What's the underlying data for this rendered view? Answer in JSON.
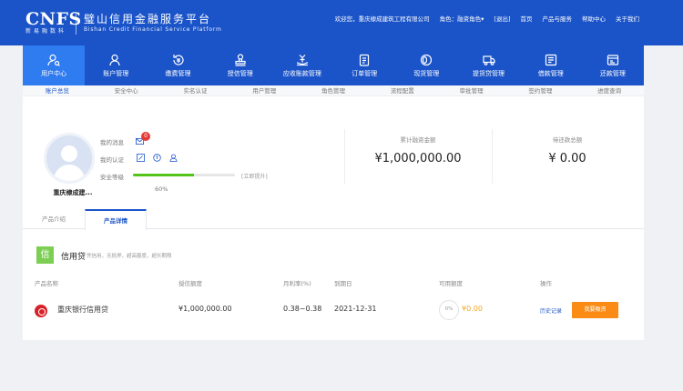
{
  "header": {
    "logo_text": "CNFS",
    "logo_sub": "新易融数科",
    "platform_cn": "璧山信用金融服务平台",
    "platform_en": "Bishan Credit Financial Service Platform",
    "links": [
      "欢迎您，重庆棣成建筑工程有限公司",
      "角色：融资角色▾",
      "[退出]",
      "首页",
      "产品与服务",
      "帮助中心",
      "关于我们"
    ]
  },
  "nav": {
    "items": [
      {
        "label": "用户中心",
        "icon": "user-center-icon"
      },
      {
        "label": "账户管理",
        "icon": "account-icon"
      },
      {
        "label": "缴费管理",
        "icon": "payment-icon"
      },
      {
        "label": "授信管理",
        "icon": "stamp-icon"
      },
      {
        "label": "应收账款管理",
        "icon": "receivable-icon"
      },
      {
        "label": "订单管理",
        "icon": "order-icon"
      },
      {
        "label": "现货管理",
        "icon": "spot-goods-icon"
      },
      {
        "label": "提货贷管理",
        "icon": "truck-icon"
      },
      {
        "label": "借款管理",
        "icon": "loan-icon"
      },
      {
        "label": "还款管理",
        "icon": "repayment-icon"
      }
    ]
  },
  "subtabs": [
    "账户总览",
    "安全中心",
    "实名认证",
    "用户管理",
    "角色管理",
    "流程配置",
    "审批管理",
    "签约管理",
    "进度查询"
  ],
  "profile": {
    "company": "重庆棣成建...",
    "messages_label": "我的消息",
    "messages_count": "0",
    "cert_label": "我的认证",
    "security_label": "安全等级",
    "security_level": 0.6,
    "security_text": "60%",
    "upgrade_label": "[立即提升]"
  },
  "stats": [
    {
      "label": "累计融资金额",
      "value": "¥1,000,000.00"
    },
    {
      "label": "待还款总额",
      "value": "¥ 0.00"
    }
  ],
  "product_tabs": [
    "产品介绍",
    "产品详情"
  ],
  "category": {
    "icon_char": "信",
    "title": "信用贷",
    "desc": "凭信用，无抵押，超高额度，超长期限"
  },
  "table": {
    "headers": [
      "产品名称",
      "授信额度",
      "月利率(%)",
      "到期日",
      "可用额度",
      "操作"
    ],
    "row": {
      "name": "重庆银行信用贷",
      "credit": "¥1,000,000.00",
      "rate": "0.38~0.38",
      "due": "2021-12-31",
      "ratio": "0%",
      "available": "¥0.00",
      "history": "历史记录",
      "apply": "我要融资"
    }
  },
  "colors": {
    "brand": "#1b54c8",
    "accent": "#fa8c16",
    "success": "#52c41a"
  }
}
